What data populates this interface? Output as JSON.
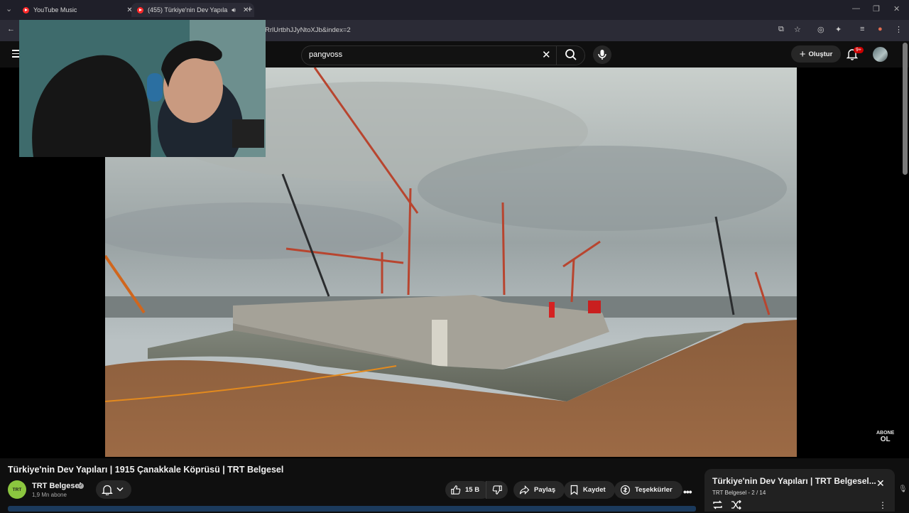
{
  "browser": {
    "tabs": [
      {
        "label": "YouTube Music",
        "icon": "youtube-music-icon"
      },
      {
        "label": "(455) Türkiye'nin Dev Yapıla",
        "icon": "youtube-icon"
      }
    ],
    "url": "RrlUrtbhJJyNtoXJb&index=2"
  },
  "youtube": {
    "search": {
      "query": "pangvoss"
    },
    "create_label": "Oluştur",
    "notification_count": "9+"
  },
  "video": {
    "title": "Türkiye'nin Dev Yapıları | 1915 Çanakkale Köprüsü | TRT Belgesel",
    "overlay": {
      "line1": "ABONE",
      "line2": "OL"
    }
  },
  "channel": {
    "logo_text": "TRT",
    "name": "TRT Belgesel",
    "subscribers": "1,9 Mn abone"
  },
  "actions": {
    "likes": "15 B",
    "share": "Paylaş",
    "save": "Kaydet",
    "thanks": "Teşekkürler"
  },
  "miniplayer": {
    "title": "Türkiye'nin Dev Yapıları | TRT Belgesel...",
    "subtitle": "TRT Belgesel - 2 / 14"
  },
  "colors": {
    "brand_red": "#ff0000",
    "background": "#0f0f0f",
    "chip": "#272727"
  }
}
